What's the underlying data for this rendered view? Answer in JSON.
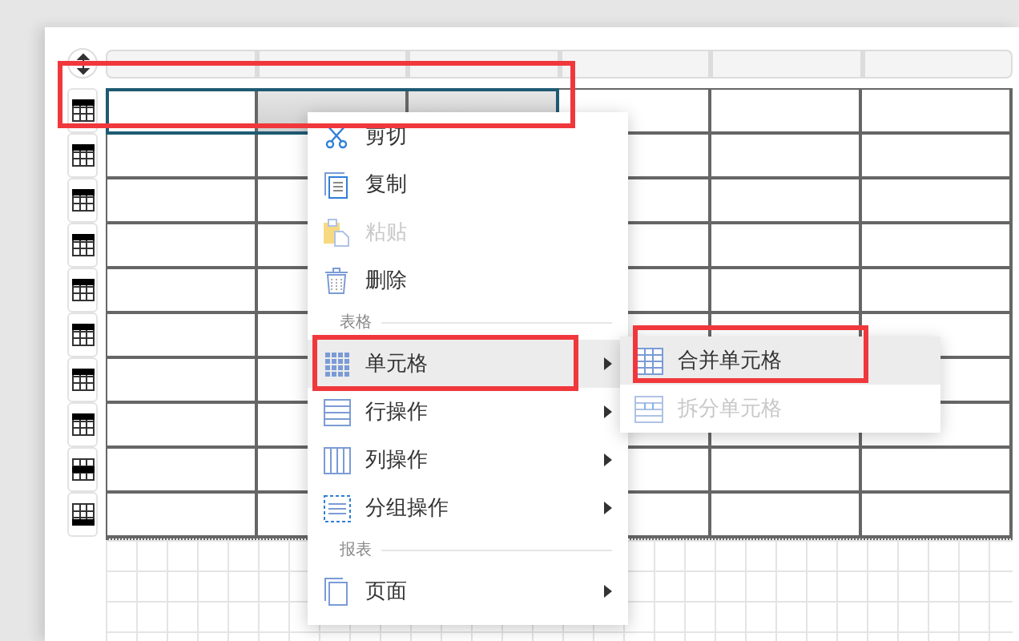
{
  "table": {
    "rows": [
      {
        "kind": "top",
        "cells": [
          {
            "active": true,
            "selected": false
          },
          {
            "active": false,
            "selected": true
          },
          {
            "active": false,
            "selected": true
          },
          {
            "active": false,
            "selected": false
          },
          {
            "active": false,
            "selected": false
          },
          {
            "active": false,
            "selected": false
          }
        ]
      },
      {
        "kind": "top"
      },
      {
        "kind": "top"
      },
      {
        "kind": "top"
      },
      {
        "kind": "top"
      },
      {
        "kind": "top"
      },
      {
        "kind": "top"
      },
      {
        "kind": "top"
      },
      {
        "kind": "middle"
      },
      {
        "kind": "bottom"
      }
    ]
  },
  "context_menu": {
    "entries": [
      {
        "kind": "item",
        "label": "剪切",
        "disabled": false,
        "selected": false,
        "submenu": false
      },
      {
        "kind": "item",
        "label": "复制",
        "disabled": false,
        "selected": false,
        "submenu": false
      },
      {
        "kind": "item",
        "label": "粘贴",
        "disabled": true,
        "selected": false,
        "submenu": false
      },
      {
        "kind": "item",
        "label": "删除",
        "disabled": false,
        "selected": false,
        "submenu": false
      },
      {
        "kind": "section",
        "label": "表格"
      },
      {
        "kind": "item",
        "label": "单元格",
        "disabled": false,
        "selected": true,
        "submenu": true
      },
      {
        "kind": "item",
        "label": "行操作",
        "disabled": false,
        "selected": false,
        "submenu": true
      },
      {
        "kind": "item",
        "label": "列操作",
        "disabled": false,
        "selected": false,
        "submenu": true
      },
      {
        "kind": "item",
        "label": "分组操作",
        "disabled": false,
        "selected": false,
        "submenu": true
      },
      {
        "kind": "section",
        "label": "报表"
      },
      {
        "kind": "item",
        "label": "页面",
        "disabled": false,
        "selected": false,
        "submenu": true
      }
    ]
  },
  "submenu": {
    "entries": [
      {
        "label": "合并单元格",
        "disabled": false,
        "selected": true
      },
      {
        "label": "拆分单元格",
        "disabled": true,
        "selected": false
      }
    ]
  }
}
